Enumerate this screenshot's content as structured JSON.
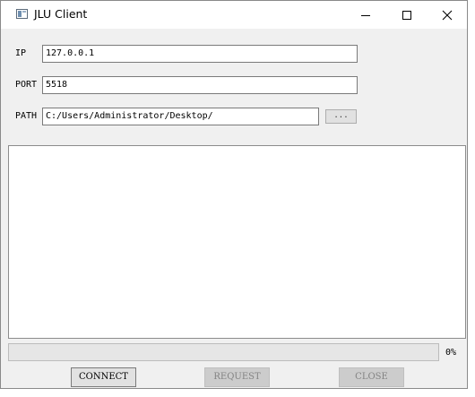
{
  "window": {
    "title": "JLU Client"
  },
  "form": {
    "ip_label": "IP",
    "ip_value": "127.0.0.1",
    "port_label": "PORT",
    "port_value": "5518",
    "path_label": "PATH",
    "path_value": "C:/Users/Administrator/Desktop/",
    "browse_label": "..."
  },
  "log": {
    "content": ""
  },
  "progress": {
    "value": 0,
    "text": "0%"
  },
  "actions": {
    "connect_label": "CONNECT",
    "request_label": "REQUEST",
    "close_label": "CLOSE"
  },
  "colors": {
    "window_bg": "#f0f0f0",
    "disabled_text": "#838383",
    "progress_fill": "#06b025"
  },
  "icons": {
    "app": "app-window-icon",
    "minimize": "minimize-icon",
    "maximize": "maximize-icon",
    "close": "close-icon"
  }
}
